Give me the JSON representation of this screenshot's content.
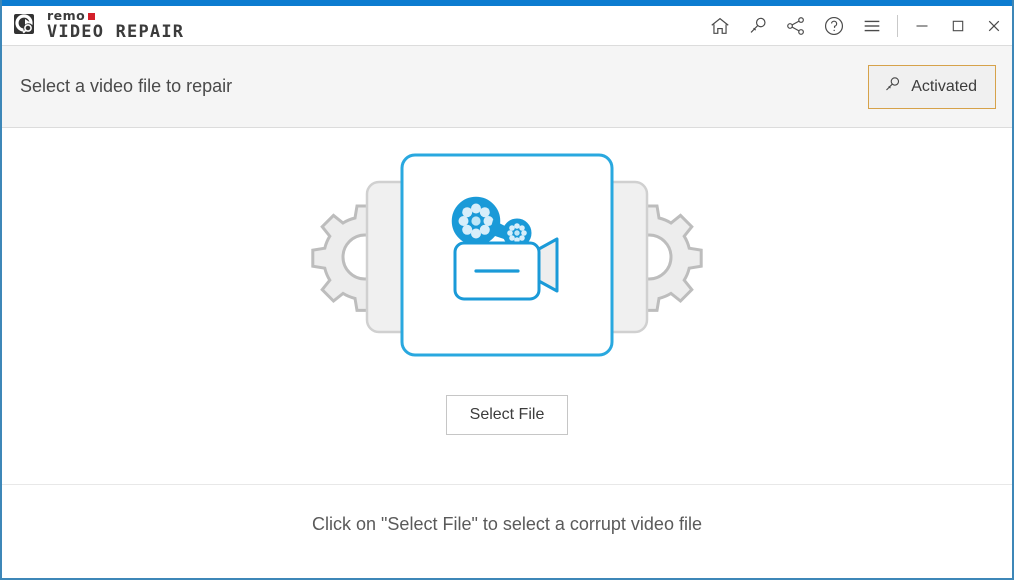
{
  "app": {
    "brand_top": "remo",
    "brand_bottom": "VIDEO REPAIR",
    "accent_color": "#0d7cd0",
    "border_color": "#3d87b8"
  },
  "titlebar": {
    "icons": [
      {
        "name": "home-icon",
        "label": "Home"
      },
      {
        "name": "key-icon",
        "label": "Activate"
      },
      {
        "name": "share-icon",
        "label": "Share"
      },
      {
        "name": "help-icon",
        "label": "Help"
      },
      {
        "name": "menu-icon",
        "label": "Menu"
      }
    ],
    "window_controls": [
      {
        "name": "minimize-button",
        "label": "Minimize"
      },
      {
        "name": "maximize-button",
        "label": "Maximize"
      },
      {
        "name": "close-button",
        "label": "Close"
      }
    ]
  },
  "header": {
    "title": "Select a video file to repair",
    "activated_label": "Activated",
    "activated_border_color": "#d6a24a",
    "activated_icon": "key-icon"
  },
  "main": {
    "illustration_name": "video-camera-gears-illustration",
    "illustration_accent": "#29a8df",
    "gear_color": "#ededed",
    "gear_outline": "#bdbdbd",
    "select_file_label": "Select File",
    "footer_hint": "Click on \"Select File\" to select a corrupt video file"
  }
}
